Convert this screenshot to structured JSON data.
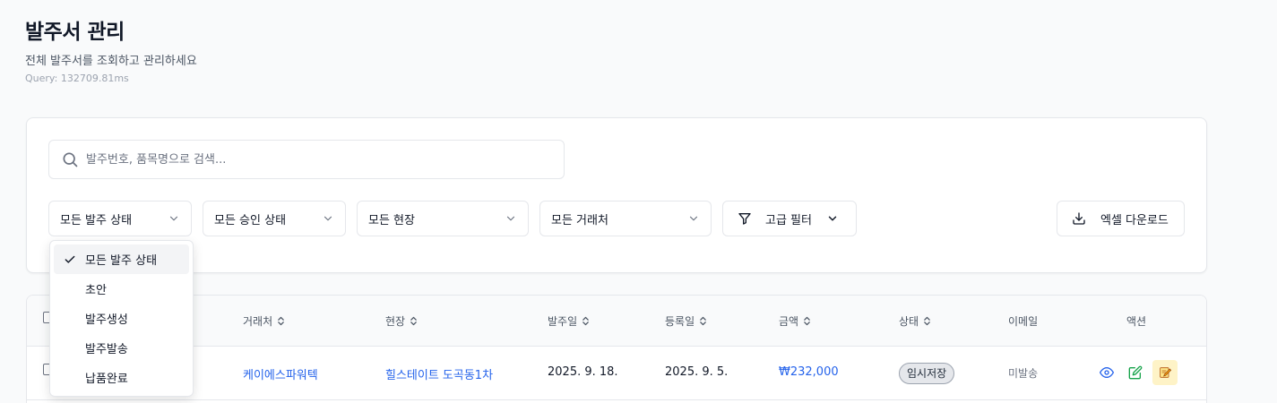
{
  "header": {
    "title": "발주서 관리",
    "subtitle": "전체 발주서를 조회하고 관리하세요",
    "query_time": "Query: 132709.81ms"
  },
  "search": {
    "placeholder": "발주번호, 품목명으로 검색...",
    "value": ""
  },
  "filters": {
    "order_status": "모든 발주 상태",
    "approval_status": "모든 승인 상태",
    "site": "모든 현장",
    "vendor": "모든 거래처",
    "advanced_label": "고급 필터",
    "export_label": "엑셀 다운로드"
  },
  "dropdown": {
    "options": [
      "모든 발주 상태",
      "초안",
      "발주생성",
      "발주발송",
      "납품완료"
    ],
    "selected": "모든 발주 상태"
  },
  "table": {
    "headers": {
      "vendor": "거래처",
      "site": "현장",
      "order_date": "발주일",
      "reg_date": "등록일",
      "amount": "금액",
      "status": "상태",
      "email": "이메일",
      "actions": "액션"
    },
    "rows": [
      {
        "vendor": "케이에스파워텍",
        "site": "힐스테이트 도곡동1차",
        "order_date": "2025. 9. 18.",
        "reg_date": "2025. 9. 5.",
        "amount": "₩232,000",
        "status": "임시저장",
        "email": "미발송"
      }
    ]
  },
  "colors": {
    "link": "#2563eb",
    "view_icon": "#2563eb",
    "edit_icon": "#16a34a",
    "draft_icon_bg": "#fef3c7"
  },
  "icons": {
    "search": "search-icon",
    "chevron": "chevron-down-icon",
    "filter": "filter-icon",
    "download": "download-icon",
    "check": "check-icon",
    "sort": "sort-icon",
    "view": "eye-icon",
    "edit": "edit-icon",
    "draft": "memo-icon"
  }
}
